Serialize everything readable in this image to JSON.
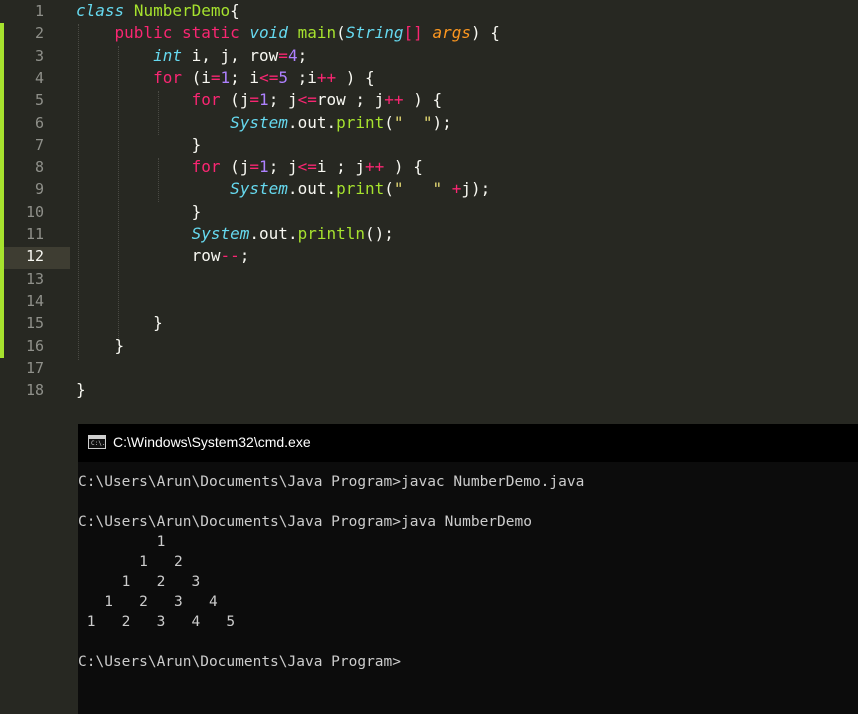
{
  "editor": {
    "line_numbers": [
      "1",
      "2",
      "3",
      "4",
      "5",
      "6",
      "7",
      "8",
      "9",
      "10",
      "11",
      "12",
      "13",
      "14",
      "15",
      "16",
      "17",
      "18"
    ],
    "active_line": "12",
    "lines": [
      [
        [
          "kw-italic-st",
          "class"
        ],
        [
          "t",
          " "
        ],
        [
          "cls",
          "NumberDemo"
        ],
        [
          "t",
          "{"
        ]
      ],
      [
        [
          "t",
          "    "
        ],
        [
          "kw",
          "public"
        ],
        [
          "t",
          " "
        ],
        [
          "kw",
          "static"
        ],
        [
          "t",
          " "
        ],
        [
          "st",
          "void"
        ],
        [
          "t",
          " "
        ],
        [
          "fn",
          "main"
        ],
        [
          "t",
          "("
        ],
        [
          "st",
          "String"
        ],
        [
          "kw",
          "[]"
        ],
        [
          "t",
          " "
        ],
        [
          "pr",
          "args"
        ],
        [
          "t",
          ") {"
        ]
      ],
      [
        [
          "t",
          "        "
        ],
        [
          "st",
          "int"
        ],
        [
          "t",
          " i, j, row"
        ],
        [
          "kw",
          "="
        ],
        [
          "nm",
          "4"
        ],
        [
          "t",
          ";"
        ]
      ],
      [
        [
          "t",
          "        "
        ],
        [
          "kw",
          "for"
        ],
        [
          "t",
          " (i"
        ],
        [
          "kw",
          "="
        ],
        [
          "nm",
          "1"
        ],
        [
          "t",
          "; i"
        ],
        [
          "kw",
          "<="
        ],
        [
          "nm",
          "5"
        ],
        [
          "t",
          " ;i"
        ],
        [
          "kw",
          "++"
        ],
        [
          "t",
          " ) {"
        ]
      ],
      [
        [
          "t",
          "            "
        ],
        [
          "kw",
          "for"
        ],
        [
          "t",
          " (j"
        ],
        [
          "kw",
          "="
        ],
        [
          "nm",
          "1"
        ],
        [
          "t",
          "; j"
        ],
        [
          "kw",
          "<="
        ],
        [
          "t",
          "row ; j"
        ],
        [
          "kw",
          "++"
        ],
        [
          "t",
          " ) {"
        ]
      ],
      [
        [
          "t",
          "                "
        ],
        [
          "st",
          "System"
        ],
        [
          "t",
          "."
        ],
        [
          "t",
          "out"
        ],
        [
          "t",
          "."
        ],
        [
          "fn",
          "print"
        ],
        [
          "t",
          "("
        ],
        [
          "sg",
          "\"  \""
        ],
        [
          "t",
          ");"
        ]
      ],
      [
        [
          "t",
          "            }"
        ]
      ],
      [
        [
          "t",
          "            "
        ],
        [
          "kw",
          "for"
        ],
        [
          "t",
          " (j"
        ],
        [
          "kw",
          "="
        ],
        [
          "nm",
          "1"
        ],
        [
          "t",
          "; j"
        ],
        [
          "kw",
          "<="
        ],
        [
          "t",
          "i ; j"
        ],
        [
          "kw",
          "++"
        ],
        [
          "t",
          " ) {"
        ]
      ],
      [
        [
          "t",
          "                "
        ],
        [
          "st",
          "System"
        ],
        [
          "t",
          "."
        ],
        [
          "t",
          "out"
        ],
        [
          "t",
          "."
        ],
        [
          "fn",
          "print"
        ],
        [
          "t",
          "("
        ],
        [
          "sg",
          "\"   \""
        ],
        [
          "t",
          " "
        ],
        [
          "kw",
          "+"
        ],
        [
          "t",
          "j);"
        ]
      ],
      [
        [
          "t",
          "            }"
        ]
      ],
      [
        [
          "t",
          "            "
        ],
        [
          "st",
          "System"
        ],
        [
          "t",
          "."
        ],
        [
          "t",
          "out"
        ],
        [
          "t",
          "."
        ],
        [
          "fn",
          "println"
        ],
        [
          "t",
          "();"
        ]
      ],
      [
        [
          "t",
          "            row"
        ],
        [
          "kw",
          "--"
        ],
        [
          "t",
          ";"
        ]
      ],
      [
        [
          "t",
          ""
        ]
      ],
      [
        [
          "t",
          ""
        ]
      ],
      [
        [
          "t",
          "        }"
        ]
      ],
      [
        [
          "t",
          "    }"
        ]
      ],
      [
        [
          "t",
          ""
        ]
      ],
      [
        [
          "t",
          "}"
        ]
      ]
    ]
  },
  "terminal": {
    "title": "C:\\Windows\\System32\\cmd.exe",
    "icon_label": "C:\\.",
    "output_lines": [
      "C:\\Users\\Arun\\Documents\\Java Program>javac NumberDemo.java",
      "",
      "C:\\Users\\Arun\\Documents\\Java Program>java NumberDemo",
      "         1",
      "       1   2",
      "     1   2   3",
      "   1   2   3   4",
      " 1   2   3   4   5",
      "",
      "C:\\Users\\Arun\\Documents\\Java Program>"
    ]
  },
  "colors": {
    "editor_bg": "#272822",
    "keyword": "#f92672",
    "storage_type": "#66d9ef",
    "function": "#a6e22e",
    "number": "#ae81ff",
    "string": "#e6db74",
    "parameter": "#fd971f",
    "terminal_bg": "#0c0c0c",
    "terminal_text": "#cccccc"
  }
}
